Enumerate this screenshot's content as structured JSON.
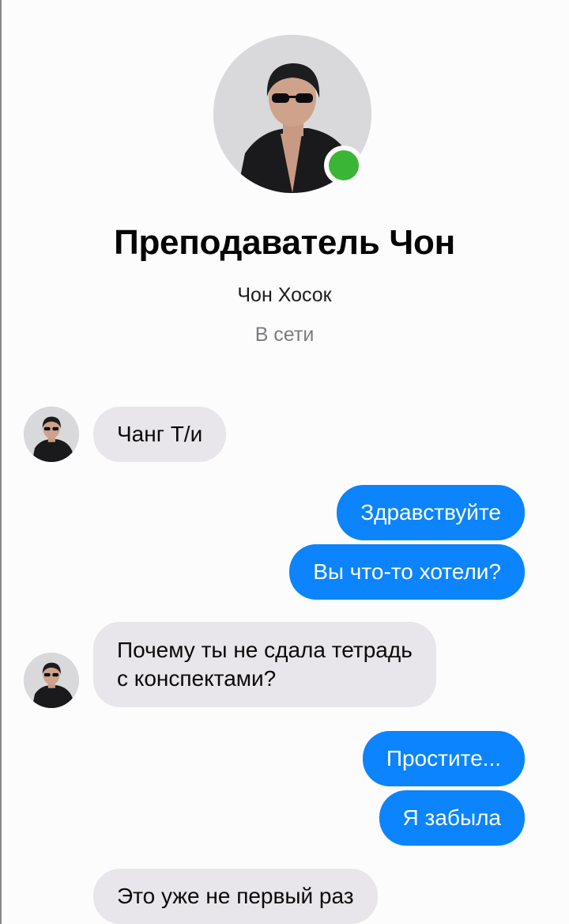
{
  "profile": {
    "title": "Преподаватель Чон",
    "subtitle": "Чон Хосок",
    "status": "В сети",
    "avatar_icon": "person-photo-icon",
    "online_color": "#3bb536"
  },
  "messages": [
    {
      "from": "contact",
      "text": "Чанг Т/и"
    },
    {
      "from": "me",
      "text": "Здравствуйте"
    },
    {
      "from": "me",
      "text": "Вы что-то хотели?"
    },
    {
      "from": "contact",
      "line1": "Почему ты не сдала тетрадь",
      "line2": "с конспектами?"
    },
    {
      "from": "me",
      "text": "Простите..."
    },
    {
      "from": "me",
      "text": "Я забыла"
    },
    {
      "from": "contact",
      "text": "Это уже не первый раз"
    }
  ],
  "colors": {
    "outgoing": "#0b84fd",
    "incoming": "#e8e6ea"
  }
}
